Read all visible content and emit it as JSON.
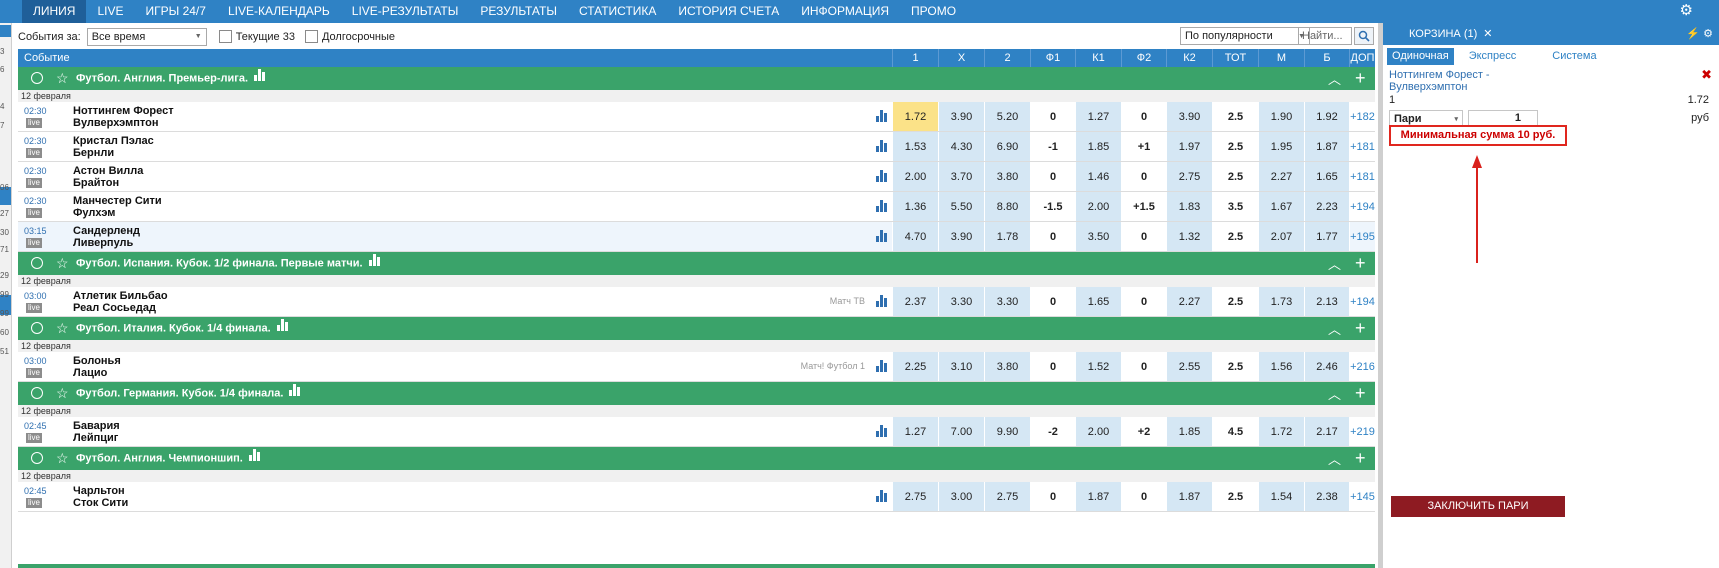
{
  "topnav": {
    "items": [
      "ЛИНИЯ",
      "LIVE",
      "ИГРЫ 24/7",
      "LIVE-КАЛЕНДАРЬ",
      "LIVE-РЕЗУЛЬТАТЫ",
      "РЕЗУЛЬТАТЫ",
      "СТАТИСТИКА",
      "ИСТОРИЯ СЧЕТА",
      "ИНФОРМАЦИЯ",
      "ПРОМО"
    ],
    "active": "ЛИНИЯ"
  },
  "leftstrip": {
    "numbers": [
      "3",
      "6",
      "4",
      "7",
      "06",
      "27",
      "30",
      "71",
      "29",
      "99",
      "99",
      "60",
      "51"
    ]
  },
  "filters": {
    "events_label": "События за:",
    "period_value": "Все время",
    "current_label": "Текущие 33",
    "longterm_label": "Долгосрочные",
    "sort_value": "По популярности",
    "search_placeholder": "Найти..."
  },
  "columns": [
    "1",
    "X",
    "2",
    "Ф1",
    "К1",
    "Ф2",
    "К2",
    "ТОТ",
    "М",
    "Б",
    "ДОП"
  ],
  "header_event_label": "Событие",
  "live_badge": "live",
  "groups": [
    {
      "name": "Футбол. Англия. Премьер-лига.",
      "date": "12 февраля",
      "matches": [
        {
          "time": "02:30",
          "team1": "Ноттингем Форест",
          "team2": "Вулверхэмптон",
          "tv": "",
          "odds": [
            "1.72",
            "3.90",
            "5.20",
            "0",
            "1.27",
            "0",
            "3.90",
            "2.5",
            "1.90",
            "1.92",
            "+182"
          ]
        },
        {
          "time": "02:30",
          "team1": "Кристал Пэлас",
          "team2": "Бернли",
          "tv": "",
          "odds": [
            "1.53",
            "4.30",
            "6.90",
            "-1",
            "1.85",
            "+1",
            "1.97",
            "2.5",
            "1.95",
            "1.87",
            "+181"
          ]
        },
        {
          "time": "02:30",
          "team1": "Астон Вилла",
          "team2": "Брайтон",
          "tv": "",
          "odds": [
            "2.00",
            "3.70",
            "3.80",
            "0",
            "1.46",
            "0",
            "2.75",
            "2.5",
            "2.27",
            "1.65",
            "+181"
          ]
        },
        {
          "time": "02:30",
          "team1": "Манчестер Сити",
          "team2": "Фулхэм",
          "tv": "",
          "odds": [
            "1.36",
            "5.50",
            "8.80",
            "-1.5",
            "2.00",
            "+1.5",
            "1.83",
            "3.5",
            "1.67",
            "2.23",
            "+194"
          ]
        },
        {
          "time": "03:15",
          "team1": "Сандерленд",
          "team2": "Ливерпуль",
          "tv": "",
          "odds": [
            "4.70",
            "3.90",
            "1.78",
            "0",
            "3.50",
            "0",
            "1.32",
            "2.5",
            "2.07",
            "1.77",
            "+195"
          ]
        }
      ]
    },
    {
      "name": "Футбол. Испания. Кубок. 1/2 финала. Первые матчи.",
      "date": "12 февраля",
      "matches": [
        {
          "time": "03:00",
          "team1": "Атлетик Бильбао",
          "team2": "Реал Сосьедад",
          "tv": "Матч ТВ",
          "odds": [
            "2.37",
            "3.30",
            "3.30",
            "0",
            "1.65",
            "0",
            "2.27",
            "2.5",
            "1.73",
            "2.13",
            "+194"
          ]
        }
      ]
    },
    {
      "name": "Футбол. Италия. Кубок. 1/4 финала.",
      "date": "12 февраля",
      "matches": [
        {
          "time": "03:00",
          "team1": "Болонья",
          "team2": "Лацио",
          "tv": "Матч! Футбол 1",
          "odds": [
            "2.25",
            "3.10",
            "3.80",
            "0",
            "1.52",
            "0",
            "2.55",
            "2.5",
            "1.56",
            "2.46",
            "+216"
          ]
        }
      ]
    },
    {
      "name": "Футбол. Германия. Кубок. 1/4 финала.",
      "date": "12 февраля",
      "matches": [
        {
          "time": "02:45",
          "team1": "Бавария",
          "team2": "Лейпциг",
          "tv": "",
          "odds": [
            "1.27",
            "7.00",
            "9.90",
            "-2",
            "2.00",
            "+2",
            "1.85",
            "4.5",
            "1.72",
            "2.17",
            "+219"
          ]
        }
      ]
    },
    {
      "name": "Футбол. Англия. Чемпионшип.",
      "date": "12 февраля",
      "matches": [
        {
          "time": "02:45",
          "team1": "Чарльтон",
          "team2": "Сток Сити",
          "tv": "",
          "odds": [
            "2.75",
            "3.00",
            "2.75",
            "0",
            "1.87",
            "0",
            "1.87",
            "2.5",
            "1.54",
            "2.38",
            "+145"
          ]
        }
      ]
    }
  ],
  "cart": {
    "title": "КОРЗИНА (1)",
    "tabs": [
      "Одиночная",
      "Экспресс",
      "Система"
    ],
    "event": "Ноттингем Форест - Вулверхэмптон",
    "outcome": "1",
    "odd": "1.72",
    "bet_type": "Пари",
    "amount": "1",
    "currency": "руб",
    "min_message": "Минимальная сумма 10 руб.",
    "place_button": "ЗАКЛЮЧИТЬ ПАРИ"
  },
  "colors": {
    "nav_blue": "#2f82c5",
    "group_green": "#3aa36a",
    "odd_blue": "#d5e7f4",
    "selected_yellow": "#fbe288",
    "error_red": "#e0261e",
    "place_button": "#8e1b22"
  }
}
